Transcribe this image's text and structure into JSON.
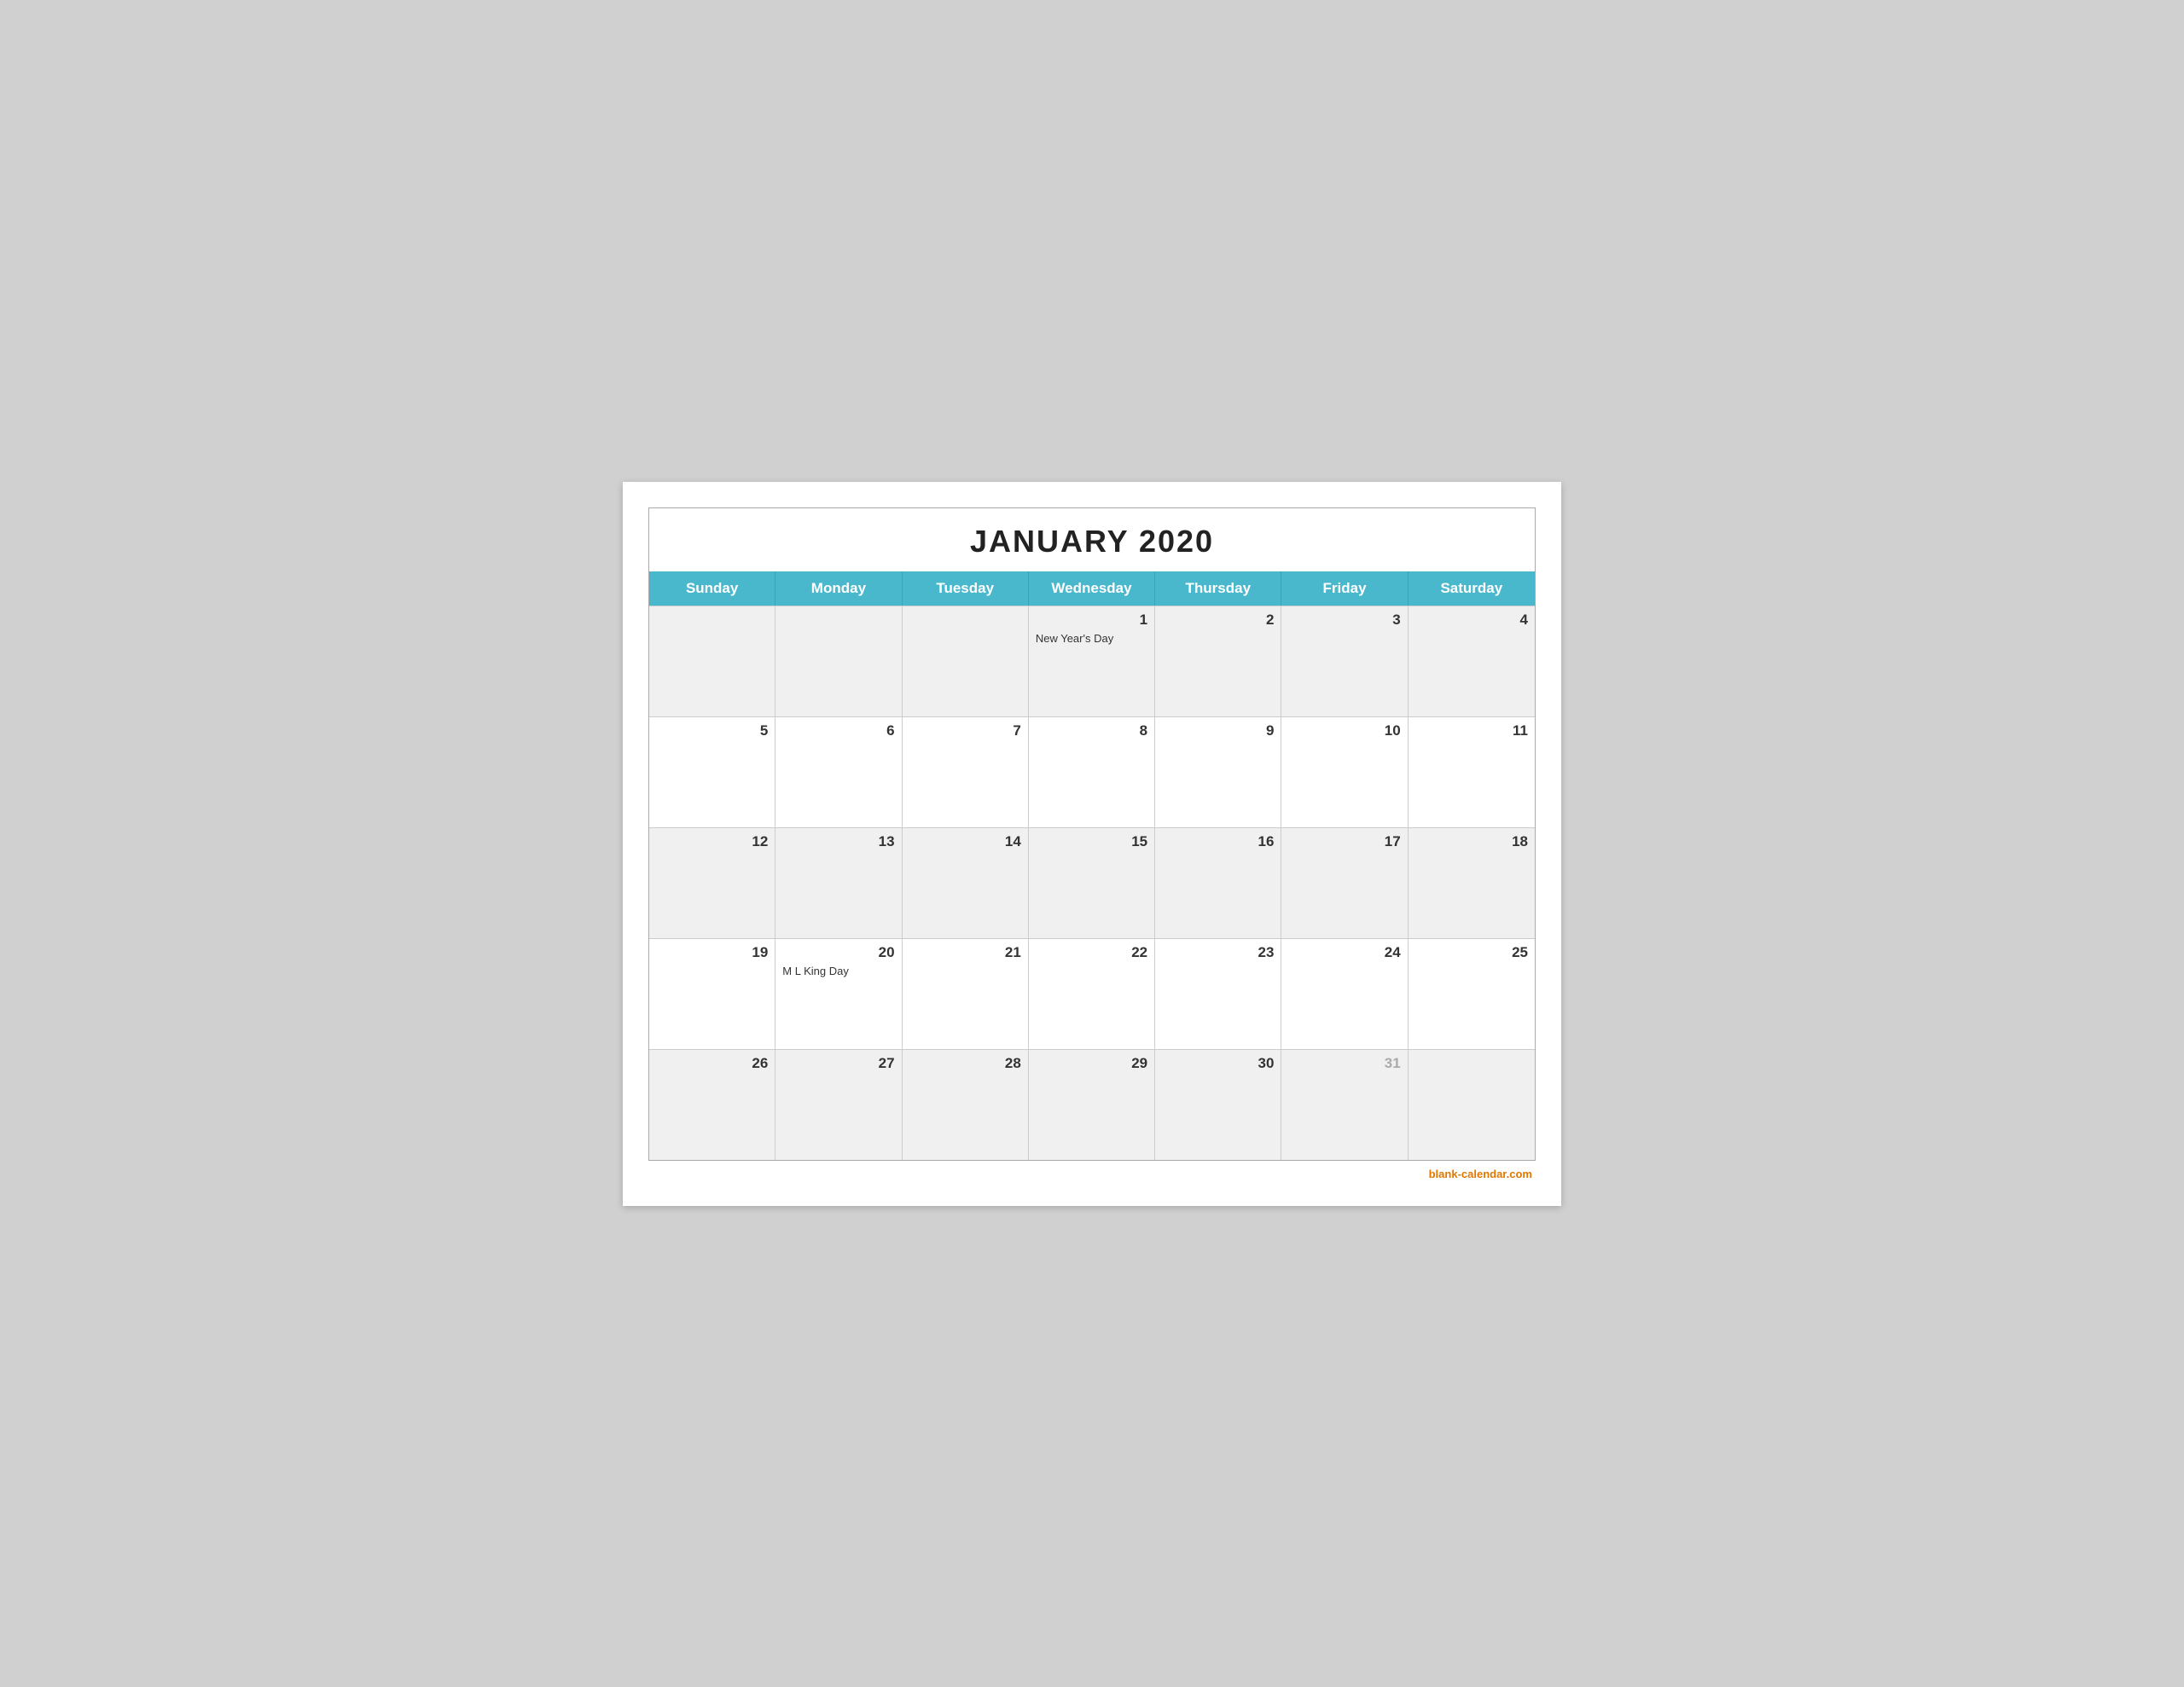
{
  "title": "JANUARY 2020",
  "headers": [
    "Sunday",
    "Monday",
    "Tuesday",
    "Wednesday",
    "Thursday",
    "Friday",
    "Saturday"
  ],
  "watermark": "blank-calendar.com",
  "weeks": [
    [
      {
        "number": "",
        "event": "",
        "grayed": false,
        "empty": true
      },
      {
        "number": "",
        "event": "",
        "grayed": false,
        "empty": true
      },
      {
        "number": "",
        "event": "",
        "grayed": false,
        "empty": true
      },
      {
        "number": "1",
        "event": "New Year's Day",
        "grayed": false,
        "empty": false
      },
      {
        "number": "2",
        "event": "",
        "grayed": false,
        "empty": false
      },
      {
        "number": "3",
        "event": "",
        "grayed": false,
        "empty": false
      },
      {
        "number": "4",
        "event": "",
        "grayed": false,
        "empty": false
      }
    ],
    [
      {
        "number": "5",
        "event": "",
        "grayed": false,
        "empty": false
      },
      {
        "number": "6",
        "event": "",
        "grayed": false,
        "empty": false
      },
      {
        "number": "7",
        "event": "",
        "grayed": false,
        "empty": false
      },
      {
        "number": "8",
        "event": "",
        "grayed": false,
        "empty": false
      },
      {
        "number": "9",
        "event": "",
        "grayed": false,
        "empty": false
      },
      {
        "number": "10",
        "event": "",
        "grayed": false,
        "empty": false
      },
      {
        "number": "11",
        "event": "",
        "grayed": false,
        "empty": false
      }
    ],
    [
      {
        "number": "12",
        "event": "",
        "grayed": false,
        "empty": false
      },
      {
        "number": "13",
        "event": "",
        "grayed": false,
        "empty": false
      },
      {
        "number": "14",
        "event": "",
        "grayed": false,
        "empty": false
      },
      {
        "number": "15",
        "event": "",
        "grayed": false,
        "empty": false
      },
      {
        "number": "16",
        "event": "",
        "grayed": false,
        "empty": false
      },
      {
        "number": "17",
        "event": "",
        "grayed": false,
        "empty": false
      },
      {
        "number": "18",
        "event": "",
        "grayed": false,
        "empty": false
      }
    ],
    [
      {
        "number": "19",
        "event": "",
        "grayed": false,
        "empty": false
      },
      {
        "number": "20",
        "event": "M L King Day",
        "grayed": false,
        "empty": false
      },
      {
        "number": "21",
        "event": "",
        "grayed": false,
        "empty": false
      },
      {
        "number": "22",
        "event": "",
        "grayed": false,
        "empty": false
      },
      {
        "number": "23",
        "event": "",
        "grayed": false,
        "empty": false
      },
      {
        "number": "24",
        "event": "",
        "grayed": false,
        "empty": false
      },
      {
        "number": "25",
        "event": "",
        "grayed": false,
        "empty": false
      }
    ],
    [
      {
        "number": "26",
        "event": "",
        "grayed": false,
        "empty": false
      },
      {
        "number": "27",
        "event": "",
        "grayed": false,
        "empty": false
      },
      {
        "number": "28",
        "event": "",
        "grayed": false,
        "empty": false
      },
      {
        "number": "29",
        "event": "",
        "grayed": false,
        "empty": false
      },
      {
        "number": "30",
        "event": "",
        "grayed": false,
        "empty": false
      },
      {
        "number": "31",
        "event": "",
        "grayed": true,
        "empty": false
      },
      {
        "number": "",
        "event": "",
        "grayed": false,
        "empty": true
      }
    ]
  ]
}
